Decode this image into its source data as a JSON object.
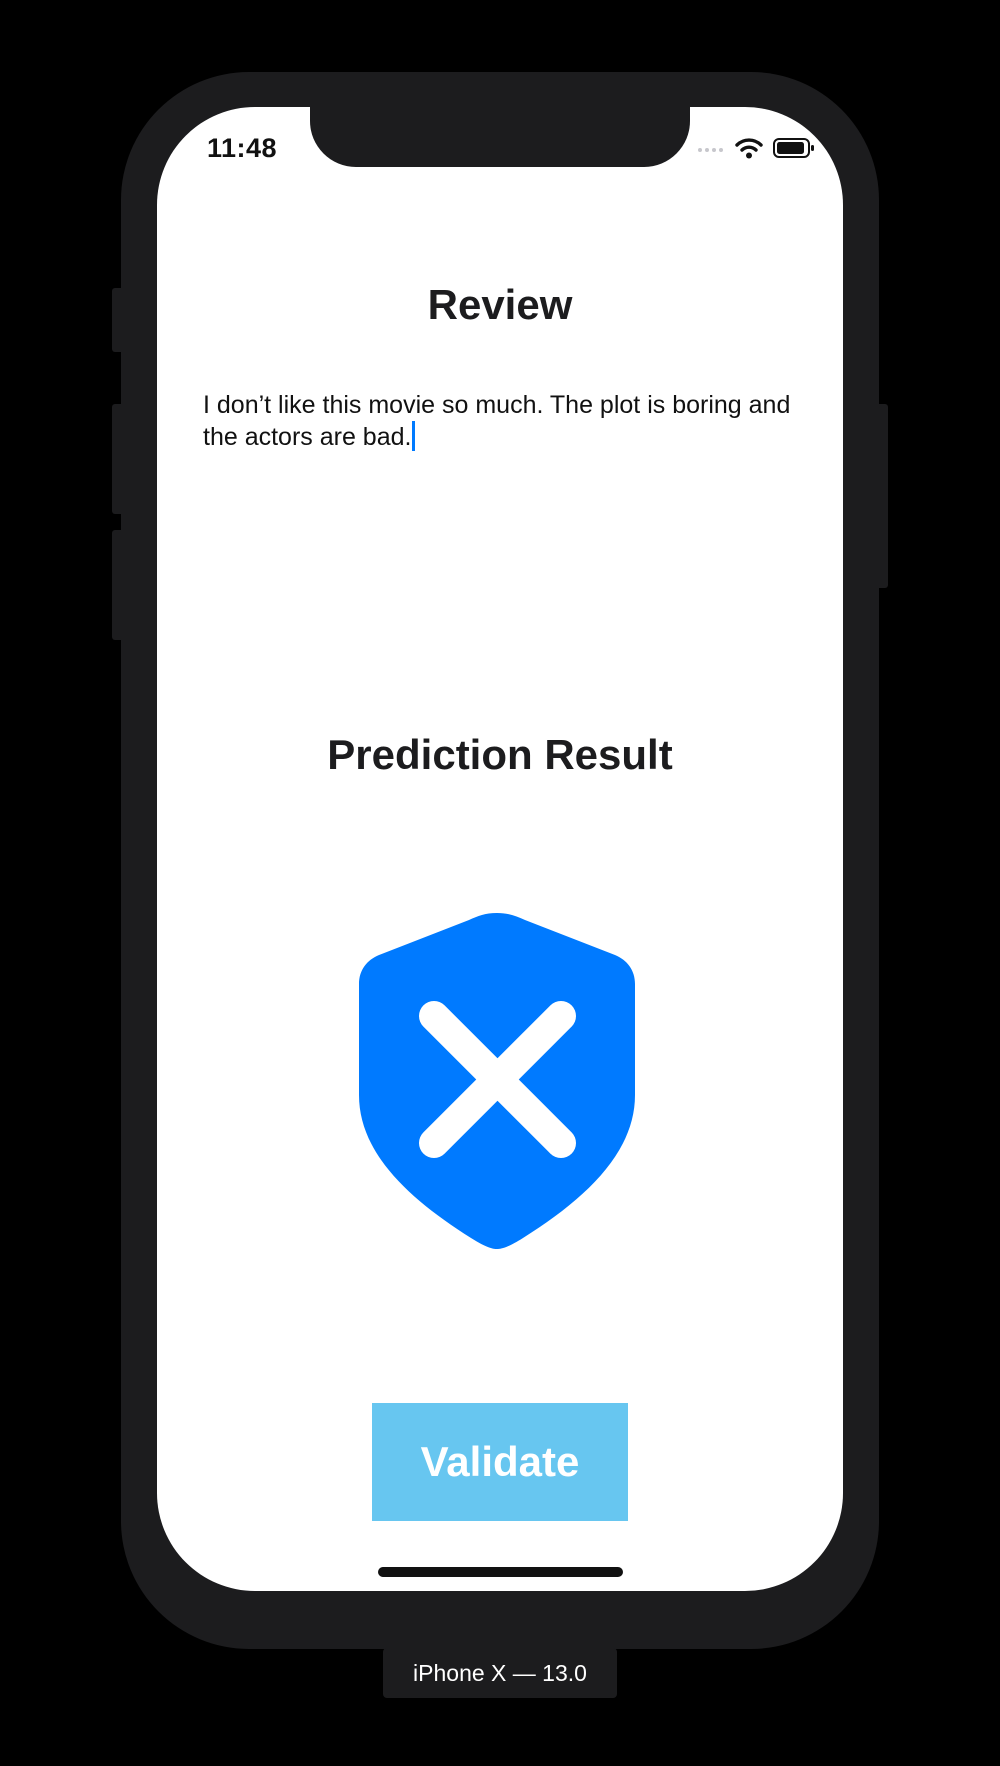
{
  "status_bar": {
    "time": "11:48",
    "wifi_icon": "wifi-icon",
    "battery_icon": "battery-icon"
  },
  "review": {
    "title": "Review",
    "text": "I don’t like this movie so much. The plot is boring and the actors are bad."
  },
  "prediction": {
    "title": "Prediction Result",
    "icon": "shield-x-icon"
  },
  "validate_button": {
    "label": "Validate"
  },
  "simulator": {
    "device_label": "iPhone X — 13.0"
  },
  "colors": {
    "accent": "#007aff",
    "button": "#67c6f0",
    "device_frame": "#1c1c1e"
  }
}
